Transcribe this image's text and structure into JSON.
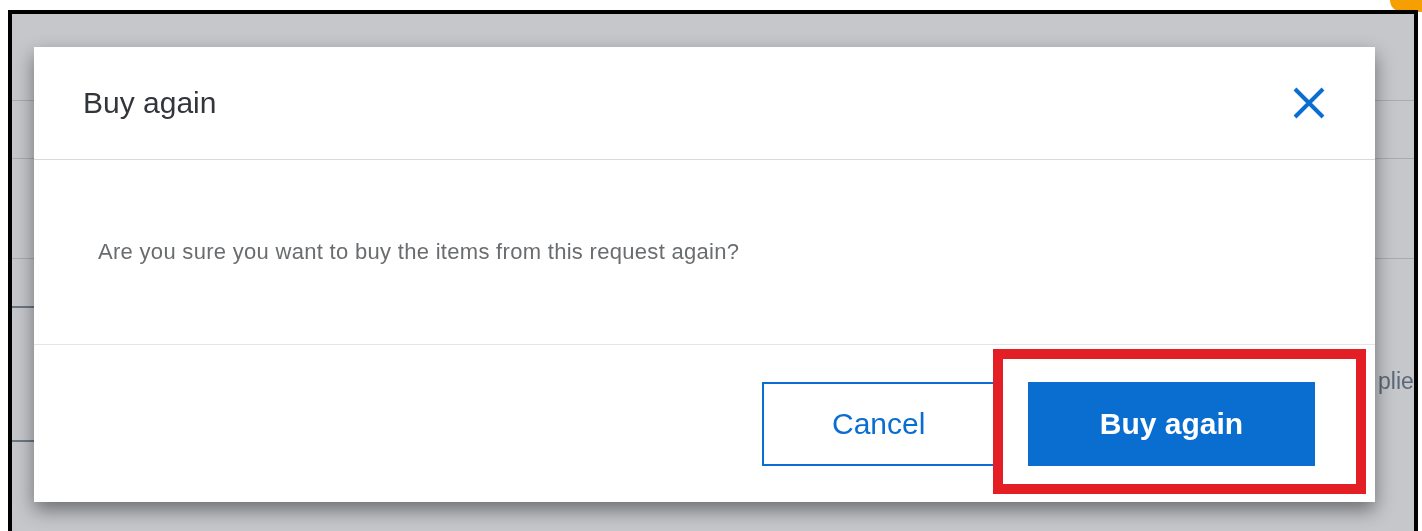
{
  "background": {
    "text": "plie"
  },
  "dialog": {
    "title": "Buy again",
    "message": "Are you sure you want to buy the items from this request again?",
    "buttons": [
      {
        "label": "Cancel",
        "kind": "secondary",
        "highlighted": false
      },
      {
        "label": "Buy again",
        "kind": "primary",
        "highlighted": true
      }
    ]
  }
}
